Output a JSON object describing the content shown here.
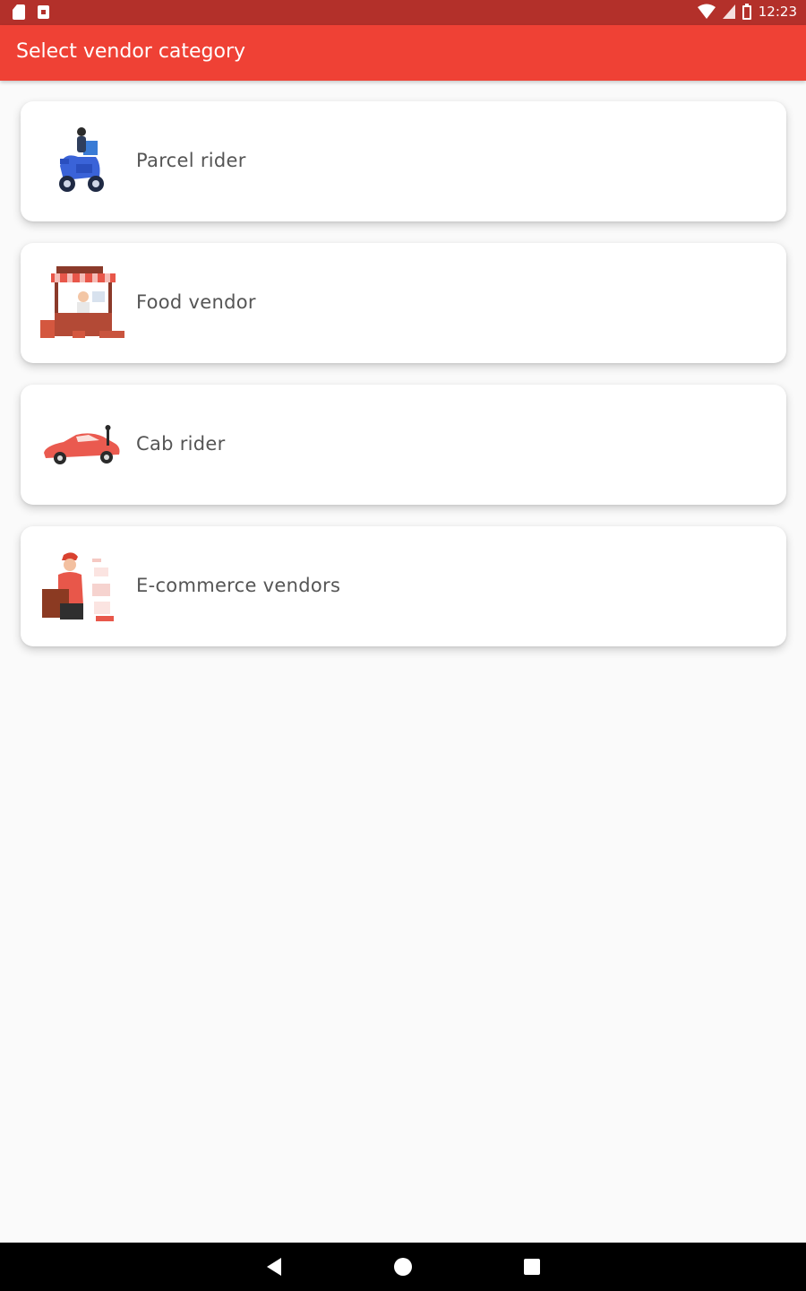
{
  "status_bar": {
    "time": "12:23",
    "left_icons": [
      "sd-card-icon",
      "notification-icon"
    ],
    "right_icons": [
      "wifi-icon",
      "signal-icon",
      "battery-icon"
    ]
  },
  "app_bar": {
    "title": "Select vendor category",
    "color": "#ef4135"
  },
  "categories": [
    {
      "label": "Parcel rider",
      "icon": "scooter-rider-icon"
    },
    {
      "label": "Food vendor",
      "icon": "food-stall-icon"
    },
    {
      "label": "Cab rider",
      "icon": "car-icon"
    },
    {
      "label": "E-commerce vendors",
      "icon": "delivery-person-icon"
    }
  ],
  "nav_bar": {
    "buttons": [
      "back-icon",
      "home-icon",
      "recents-icon"
    ]
  }
}
